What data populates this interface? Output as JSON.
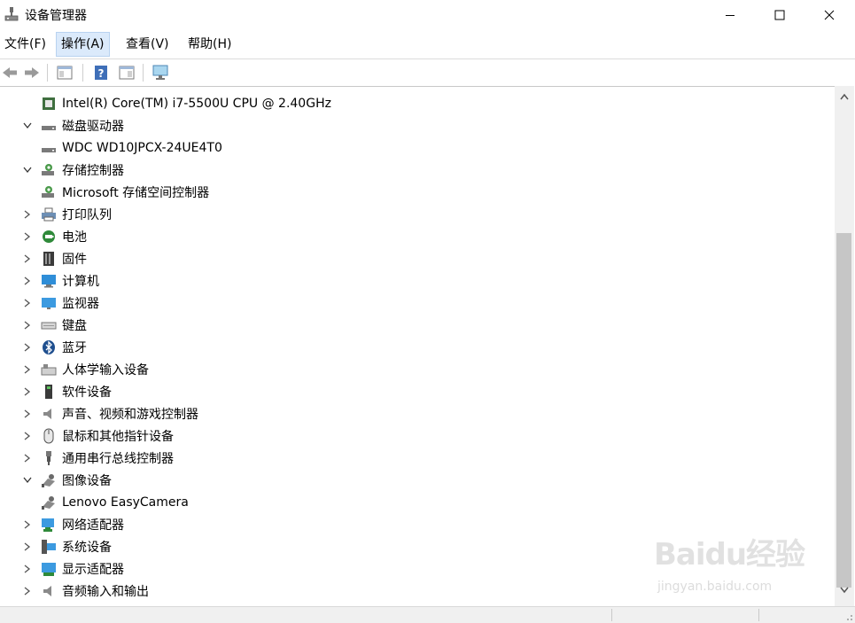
{
  "window": {
    "title": "设备管理器"
  },
  "menu": [
    "文件(F)",
    "操作(A)",
    "查看(V)",
    "帮助(H)"
  ],
  "tree": [
    {
      "indent": 1,
      "expander": "none",
      "icon": "cpu-icon",
      "label": "Intel(R) Core(TM) i7-5500U CPU @ 2.40GHz"
    },
    {
      "indent": 0,
      "expander": "expanded",
      "icon": "disk-drive-icon",
      "label": "磁盘驱动器"
    },
    {
      "indent": 1,
      "expander": "none",
      "icon": "disk-drive-icon",
      "label": "WDC WD10JPCX-24UE4T0"
    },
    {
      "indent": 0,
      "expander": "expanded",
      "icon": "storage-controller-icon",
      "label": "存储控制器"
    },
    {
      "indent": 1,
      "expander": "none",
      "icon": "storage-controller-icon",
      "label": "Microsoft 存储空间控制器"
    },
    {
      "indent": 0,
      "expander": "collapsed",
      "icon": "printer-icon",
      "label": "打印队列"
    },
    {
      "indent": 0,
      "expander": "collapsed",
      "icon": "battery-icon",
      "label": "电池"
    },
    {
      "indent": 0,
      "expander": "collapsed",
      "icon": "firmware-icon",
      "label": "固件"
    },
    {
      "indent": 0,
      "expander": "collapsed",
      "icon": "computer-icon",
      "label": "计算机"
    },
    {
      "indent": 0,
      "expander": "collapsed",
      "icon": "monitor-icon",
      "label": "监视器"
    },
    {
      "indent": 0,
      "expander": "collapsed",
      "icon": "keyboard-icon",
      "label": "键盘"
    },
    {
      "indent": 0,
      "expander": "collapsed",
      "icon": "bluetooth-icon",
      "label": "蓝牙"
    },
    {
      "indent": 0,
      "expander": "collapsed",
      "icon": "hid-icon",
      "label": "人体学输入设备"
    },
    {
      "indent": 0,
      "expander": "collapsed",
      "icon": "software-device-icon",
      "label": "软件设备"
    },
    {
      "indent": 0,
      "expander": "collapsed",
      "icon": "speaker-icon",
      "label": "声音、视频和游戏控制器"
    },
    {
      "indent": 0,
      "expander": "collapsed",
      "icon": "mouse-icon",
      "label": "鼠标和其他指针设备"
    },
    {
      "indent": 0,
      "expander": "collapsed",
      "icon": "usb-icon",
      "label": "通用串行总线控制器"
    },
    {
      "indent": 0,
      "expander": "expanded",
      "icon": "camera-icon",
      "label": "图像设备"
    },
    {
      "indent": 1,
      "expander": "none",
      "icon": "camera-icon",
      "label": "Lenovo EasyCamera"
    },
    {
      "indent": 0,
      "expander": "collapsed",
      "icon": "network-adapter-icon",
      "label": "网络适配器"
    },
    {
      "indent": 0,
      "expander": "collapsed",
      "icon": "system-device-icon",
      "label": "系统设备"
    },
    {
      "indent": 0,
      "expander": "collapsed",
      "icon": "display-adapter-icon",
      "label": "显示适配器"
    },
    {
      "indent": 0,
      "expander": "collapsed",
      "icon": "audio-io-icon",
      "label": "音频输入和输出"
    }
  ],
  "watermark": {
    "logo": "Baidu经验",
    "url": "jingyan.baidu.com"
  },
  "colors": {
    "menu_active_bg": "#dbeafb",
    "scroll_thumb": "#c6c6c6",
    "status_bg": "#f0f0f0"
  }
}
